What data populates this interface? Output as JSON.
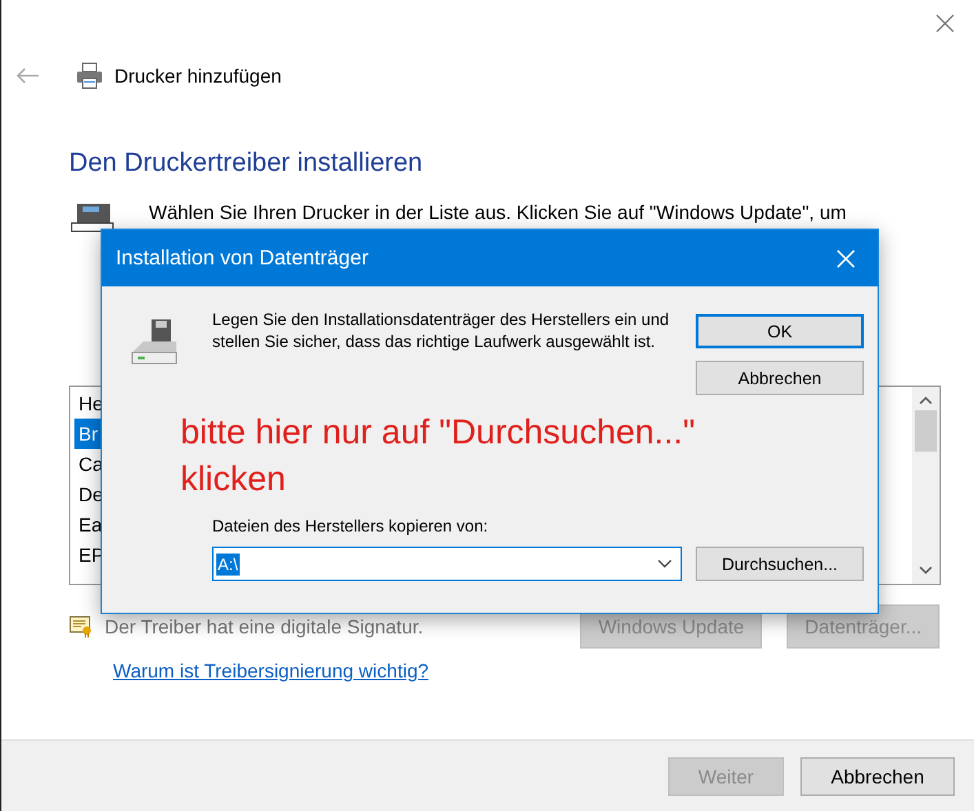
{
  "header": {
    "title": "Drucker hinzufügen"
  },
  "heading": "Den Druckertreiber installieren",
  "intro": "Wählen Sie Ihren Drucker in der Liste aus. Klicken Sie auf \"Windows Update\", um",
  "manufacturers": [
    {
      "label": "He",
      "selected": false
    },
    {
      "label": "Br",
      "selected": true
    },
    {
      "label": "Ca",
      "selected": false
    },
    {
      "label": "De",
      "selected": false
    },
    {
      "label": "Ea",
      "selected": false
    },
    {
      "label": "EP",
      "selected": false
    }
  ],
  "signature": "Der Treiber hat eine digitale Signatur.",
  "side_buttons": [
    {
      "label": "Windows Update",
      "disabled": true
    },
    {
      "label": "Datenträger...",
      "disabled": true
    }
  ],
  "link": "Warum ist Treibersignierung wichtig?",
  "footer_buttons": [
    {
      "label": "Weiter",
      "disabled": true
    },
    {
      "label": "Abbrechen",
      "disabled": false
    }
  ],
  "dialog": {
    "title": "Installation von Datenträger",
    "message": "Legen Sie den Installationsdatenträger des Herstellers ein und stellen Sie sicher, dass das richtige Laufwerk ausgewählt ist.",
    "buttons": [
      {
        "label": "OK",
        "default": true
      },
      {
        "label": "Abbrechen",
        "default": false
      }
    ],
    "annotation": "bitte hier nur auf \"Durchsuchen...\" klicken",
    "copy_from": {
      "label": "Dateien des Herstellers kopieren von:",
      "value": "A:\\",
      "selected": true
    },
    "browse": "Durchsuchen..."
  }
}
